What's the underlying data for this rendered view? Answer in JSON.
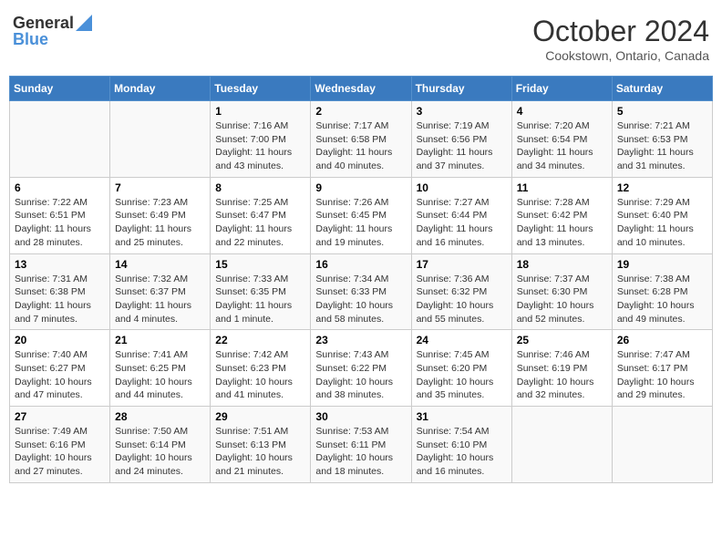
{
  "header": {
    "logo_general": "General",
    "logo_blue": "Blue",
    "month_title": "October 2024",
    "location": "Cookstown, Ontario, Canada"
  },
  "days_of_week": [
    "Sunday",
    "Monday",
    "Tuesday",
    "Wednesday",
    "Thursday",
    "Friday",
    "Saturday"
  ],
  "weeks": [
    [
      {
        "num": "",
        "sunrise": "",
        "sunset": "",
        "daylight": ""
      },
      {
        "num": "",
        "sunrise": "",
        "sunset": "",
        "daylight": ""
      },
      {
        "num": "1",
        "sunrise": "Sunrise: 7:16 AM",
        "sunset": "Sunset: 7:00 PM",
        "daylight": "Daylight: 11 hours and 43 minutes."
      },
      {
        "num": "2",
        "sunrise": "Sunrise: 7:17 AM",
        "sunset": "Sunset: 6:58 PM",
        "daylight": "Daylight: 11 hours and 40 minutes."
      },
      {
        "num": "3",
        "sunrise": "Sunrise: 7:19 AM",
        "sunset": "Sunset: 6:56 PM",
        "daylight": "Daylight: 11 hours and 37 minutes."
      },
      {
        "num": "4",
        "sunrise": "Sunrise: 7:20 AM",
        "sunset": "Sunset: 6:54 PM",
        "daylight": "Daylight: 11 hours and 34 minutes."
      },
      {
        "num": "5",
        "sunrise": "Sunrise: 7:21 AM",
        "sunset": "Sunset: 6:53 PM",
        "daylight": "Daylight: 11 hours and 31 minutes."
      }
    ],
    [
      {
        "num": "6",
        "sunrise": "Sunrise: 7:22 AM",
        "sunset": "Sunset: 6:51 PM",
        "daylight": "Daylight: 11 hours and 28 minutes."
      },
      {
        "num": "7",
        "sunrise": "Sunrise: 7:23 AM",
        "sunset": "Sunset: 6:49 PM",
        "daylight": "Daylight: 11 hours and 25 minutes."
      },
      {
        "num": "8",
        "sunrise": "Sunrise: 7:25 AM",
        "sunset": "Sunset: 6:47 PM",
        "daylight": "Daylight: 11 hours and 22 minutes."
      },
      {
        "num": "9",
        "sunrise": "Sunrise: 7:26 AM",
        "sunset": "Sunset: 6:45 PM",
        "daylight": "Daylight: 11 hours and 19 minutes."
      },
      {
        "num": "10",
        "sunrise": "Sunrise: 7:27 AM",
        "sunset": "Sunset: 6:44 PM",
        "daylight": "Daylight: 11 hours and 16 minutes."
      },
      {
        "num": "11",
        "sunrise": "Sunrise: 7:28 AM",
        "sunset": "Sunset: 6:42 PM",
        "daylight": "Daylight: 11 hours and 13 minutes."
      },
      {
        "num": "12",
        "sunrise": "Sunrise: 7:29 AM",
        "sunset": "Sunset: 6:40 PM",
        "daylight": "Daylight: 11 hours and 10 minutes."
      }
    ],
    [
      {
        "num": "13",
        "sunrise": "Sunrise: 7:31 AM",
        "sunset": "Sunset: 6:38 PM",
        "daylight": "Daylight: 11 hours and 7 minutes."
      },
      {
        "num": "14",
        "sunrise": "Sunrise: 7:32 AM",
        "sunset": "Sunset: 6:37 PM",
        "daylight": "Daylight: 11 hours and 4 minutes."
      },
      {
        "num": "15",
        "sunrise": "Sunrise: 7:33 AM",
        "sunset": "Sunset: 6:35 PM",
        "daylight": "Daylight: 11 hours and 1 minute."
      },
      {
        "num": "16",
        "sunrise": "Sunrise: 7:34 AM",
        "sunset": "Sunset: 6:33 PM",
        "daylight": "Daylight: 10 hours and 58 minutes."
      },
      {
        "num": "17",
        "sunrise": "Sunrise: 7:36 AM",
        "sunset": "Sunset: 6:32 PM",
        "daylight": "Daylight: 10 hours and 55 minutes."
      },
      {
        "num": "18",
        "sunrise": "Sunrise: 7:37 AM",
        "sunset": "Sunset: 6:30 PM",
        "daylight": "Daylight: 10 hours and 52 minutes."
      },
      {
        "num": "19",
        "sunrise": "Sunrise: 7:38 AM",
        "sunset": "Sunset: 6:28 PM",
        "daylight": "Daylight: 10 hours and 49 minutes."
      }
    ],
    [
      {
        "num": "20",
        "sunrise": "Sunrise: 7:40 AM",
        "sunset": "Sunset: 6:27 PM",
        "daylight": "Daylight: 10 hours and 47 minutes."
      },
      {
        "num": "21",
        "sunrise": "Sunrise: 7:41 AM",
        "sunset": "Sunset: 6:25 PM",
        "daylight": "Daylight: 10 hours and 44 minutes."
      },
      {
        "num": "22",
        "sunrise": "Sunrise: 7:42 AM",
        "sunset": "Sunset: 6:23 PM",
        "daylight": "Daylight: 10 hours and 41 minutes."
      },
      {
        "num": "23",
        "sunrise": "Sunrise: 7:43 AM",
        "sunset": "Sunset: 6:22 PM",
        "daylight": "Daylight: 10 hours and 38 minutes."
      },
      {
        "num": "24",
        "sunrise": "Sunrise: 7:45 AM",
        "sunset": "Sunset: 6:20 PM",
        "daylight": "Daylight: 10 hours and 35 minutes."
      },
      {
        "num": "25",
        "sunrise": "Sunrise: 7:46 AM",
        "sunset": "Sunset: 6:19 PM",
        "daylight": "Daylight: 10 hours and 32 minutes."
      },
      {
        "num": "26",
        "sunrise": "Sunrise: 7:47 AM",
        "sunset": "Sunset: 6:17 PM",
        "daylight": "Daylight: 10 hours and 29 minutes."
      }
    ],
    [
      {
        "num": "27",
        "sunrise": "Sunrise: 7:49 AM",
        "sunset": "Sunset: 6:16 PM",
        "daylight": "Daylight: 10 hours and 27 minutes."
      },
      {
        "num": "28",
        "sunrise": "Sunrise: 7:50 AM",
        "sunset": "Sunset: 6:14 PM",
        "daylight": "Daylight: 10 hours and 24 minutes."
      },
      {
        "num": "29",
        "sunrise": "Sunrise: 7:51 AM",
        "sunset": "Sunset: 6:13 PM",
        "daylight": "Daylight: 10 hours and 21 minutes."
      },
      {
        "num": "30",
        "sunrise": "Sunrise: 7:53 AM",
        "sunset": "Sunset: 6:11 PM",
        "daylight": "Daylight: 10 hours and 18 minutes."
      },
      {
        "num": "31",
        "sunrise": "Sunrise: 7:54 AM",
        "sunset": "Sunset: 6:10 PM",
        "daylight": "Daylight: 10 hours and 16 minutes."
      },
      {
        "num": "",
        "sunrise": "",
        "sunset": "",
        "daylight": ""
      },
      {
        "num": "",
        "sunrise": "",
        "sunset": "",
        "daylight": ""
      }
    ]
  ]
}
